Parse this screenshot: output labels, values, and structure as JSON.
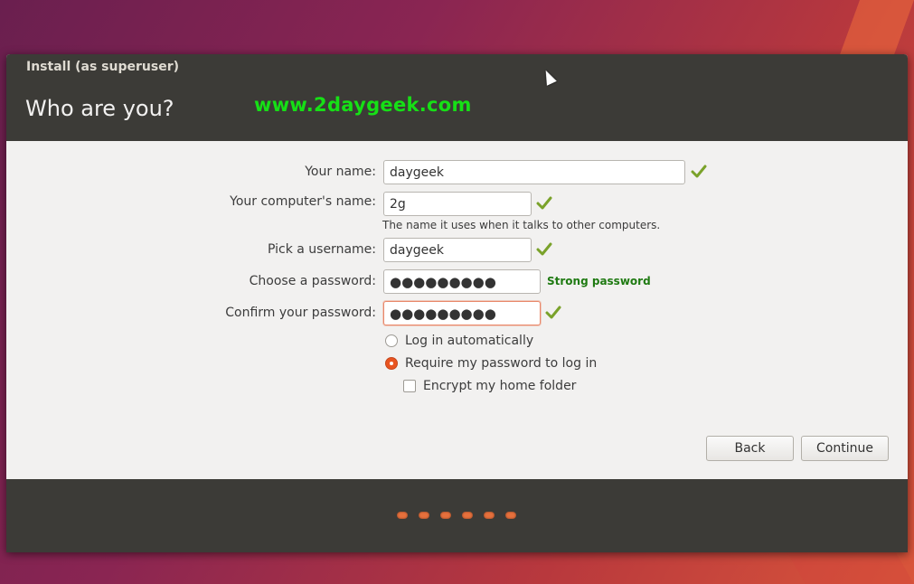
{
  "window": {
    "title": "Install (as superuser)",
    "page_title": "Who are you?",
    "watermark": "www.2daygeek.com"
  },
  "form": {
    "name": {
      "label": "Your name:",
      "value": "daygeek",
      "valid": true
    },
    "computer": {
      "label": "Your computer's name:",
      "value": "2g",
      "hint": "The name it uses when it talks to other computers.",
      "valid": true
    },
    "username": {
      "label": "Pick a username:",
      "value": "daygeek",
      "valid": true
    },
    "password": {
      "label": "Choose a password:",
      "value": "●●●●●●●●●",
      "strength": "Strong password"
    },
    "confirm": {
      "label": "Confirm your password:",
      "value": "●●●●●●●●●",
      "valid": true
    }
  },
  "options": {
    "auto_login": {
      "label": "Log in automatically",
      "selected": false
    },
    "require_password": {
      "label": "Require my password to log in",
      "selected": true
    },
    "encrypt_home": {
      "label": "Encrypt my home folder",
      "checked": false
    }
  },
  "buttons": {
    "back": "Back",
    "continue": "Continue"
  },
  "progress": {
    "total_steps": 6
  },
  "icons": {
    "valid": "checkmark-icon",
    "cursor": "mouse-pointer-icon"
  },
  "colors": {
    "accent": "#e95420",
    "valid": "#7aa22a",
    "strength": "#1f7a12",
    "watermark": "#16e016",
    "header": "#3c3b37"
  }
}
